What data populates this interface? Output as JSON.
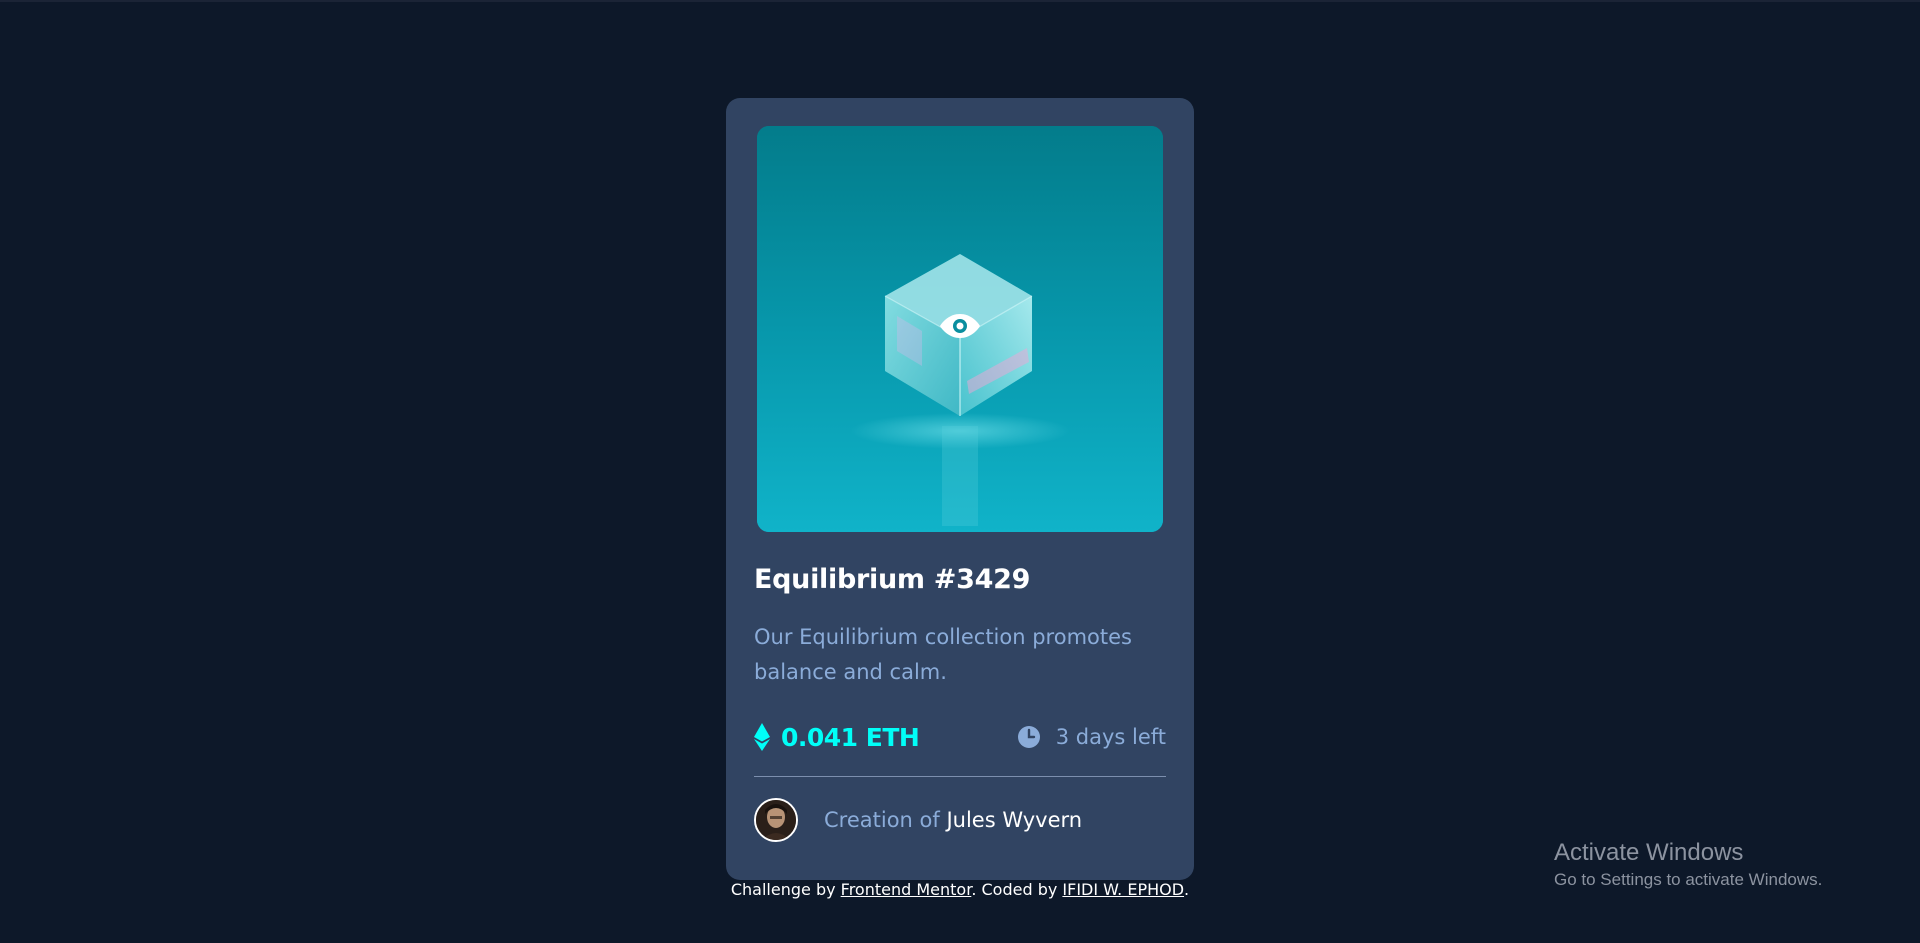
{
  "card": {
    "title": "Equilibrium #3429",
    "description": "Our Equilibrium collection promotes balance and calm.",
    "price": "0.041 ETH",
    "time_left": "3 days left",
    "creation_prefix": "Creation of",
    "author_name": "Jules Wyvern",
    "image_icon": "eye-icon",
    "price_icon": "ethereum-icon",
    "time_icon": "clock-icon"
  },
  "attribution": {
    "challenge_prefix": "Challenge by",
    "challenge_link": "Frontend Mentor",
    "coded_prefix": ". Coded by",
    "coded_link": "IFIDI W. EPHOD",
    "suffix": "."
  },
  "watermark": {
    "title": "Activate Windows",
    "subtitle": "Go to Settings to activate Windows."
  },
  "colors": {
    "background": "#0d1829",
    "card": "#314462",
    "accent_cyan": "#00fff8",
    "soft_blue": "#8bacd9",
    "white": "#ffffff"
  }
}
